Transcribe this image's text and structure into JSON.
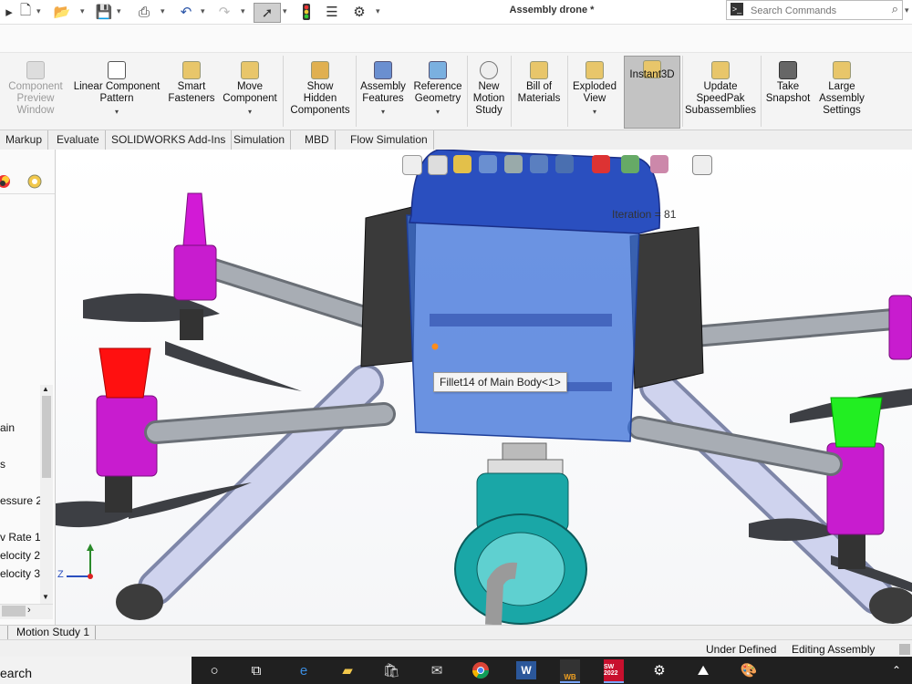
{
  "window": {
    "title": "Assembly drone *"
  },
  "search": {
    "placeholder": "Search Commands"
  },
  "ribbon": {
    "buttons": [
      {
        "label": "Component\nPreview\nWindow",
        "disabled": true
      },
      {
        "label": "Linear Component\nPattern"
      },
      {
        "label": "Smart\nFasteners"
      },
      {
        "label": "Move\nComponent"
      },
      {
        "label": "Show\nHidden\nComponents"
      },
      {
        "label": "Assembly\nFeatures"
      },
      {
        "label": "Reference\nGeometry"
      },
      {
        "label": "New\nMotion\nStudy"
      },
      {
        "label": "Bill of\nMaterials"
      },
      {
        "label": "Exploded\nView"
      },
      {
        "label": "Instant3D"
      },
      {
        "label": "Update\nSpeedPak\nSubassemblies"
      },
      {
        "label": "Take\nSnapshot"
      },
      {
        "label": "Large\nAssembly\nSettings"
      }
    ]
  },
  "tabs": [
    "Markup",
    "Evaluate",
    "SOLIDWORKS Add-Ins",
    "Simulation",
    "MBD",
    "Flow Simulation"
  ],
  "left_panel": {
    "items": [
      "ain",
      "s",
      "essure 2",
      "v Rate 1",
      "elocity 2",
      "elocity 3"
    ]
  },
  "viewport": {
    "iteration_text": "Iteration = 81",
    "tooltip": "Fillet14 of Main Body<1>",
    "triad_z": "Z"
  },
  "bottom_tabs": [
    "Motion Study 1"
  ],
  "status": {
    "definition": "Under Defined",
    "mode": "Editing Assembly"
  },
  "taskbar": {
    "search_text": "earch",
    "apps": [
      "WB",
      "SW 2022"
    ]
  },
  "colors": {
    "body_blue": "#3a6fd8",
    "lid_blue": "#2a4fbf",
    "arm_gray": "#9aa0a8",
    "mount_magenta": "#d21ad6",
    "cap_red": "#ff1010",
    "cap_green": "#22ee22",
    "camera_teal": "#1aa7a7",
    "instant3d_bg": "#c3c3c3"
  }
}
